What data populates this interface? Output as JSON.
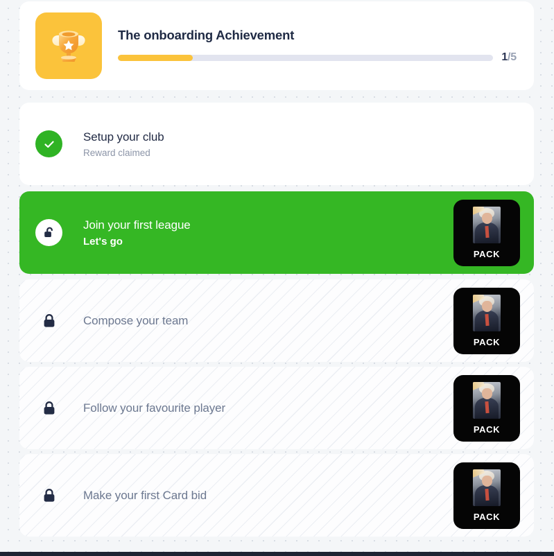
{
  "achievement": {
    "icon": "trophy-icon",
    "title": "The onboarding Achievement",
    "progress_current": "1",
    "progress_separator": "/5",
    "progress_percent": 20,
    "accent_color": "#fbc33b",
    "track_color": "#e2e4ef"
  },
  "tasks": [
    {
      "state": "done",
      "icon": "check-circle-icon",
      "title": "Setup your club",
      "subtitle": "Reward claimed",
      "has_pack": false,
      "pack_label": ""
    },
    {
      "state": "active",
      "icon": "unlocked-padlock-icon",
      "title": "Join your first league",
      "subtitle": "Let's go",
      "has_pack": true,
      "pack_label": "PACK"
    },
    {
      "state": "locked",
      "icon": "locked-padlock-icon",
      "title": "Compose your team",
      "subtitle": "",
      "has_pack": true,
      "pack_label": "PACK"
    },
    {
      "state": "locked",
      "icon": "locked-padlock-icon",
      "title": "Follow your favourite player",
      "subtitle": "",
      "has_pack": true,
      "pack_label": "PACK"
    },
    {
      "state": "locked",
      "icon": "locked-padlock-icon",
      "title": "Make your first Card bid",
      "subtitle": "",
      "has_pack": true,
      "pack_label": "PACK"
    }
  ],
  "colors": {
    "page_background": "#f4f6f8",
    "card_background": "#ffffff",
    "active_green": "#35b724",
    "done_green": "#2fb324",
    "pack_black": "#050505",
    "bottom_bar": "#1e2433"
  }
}
